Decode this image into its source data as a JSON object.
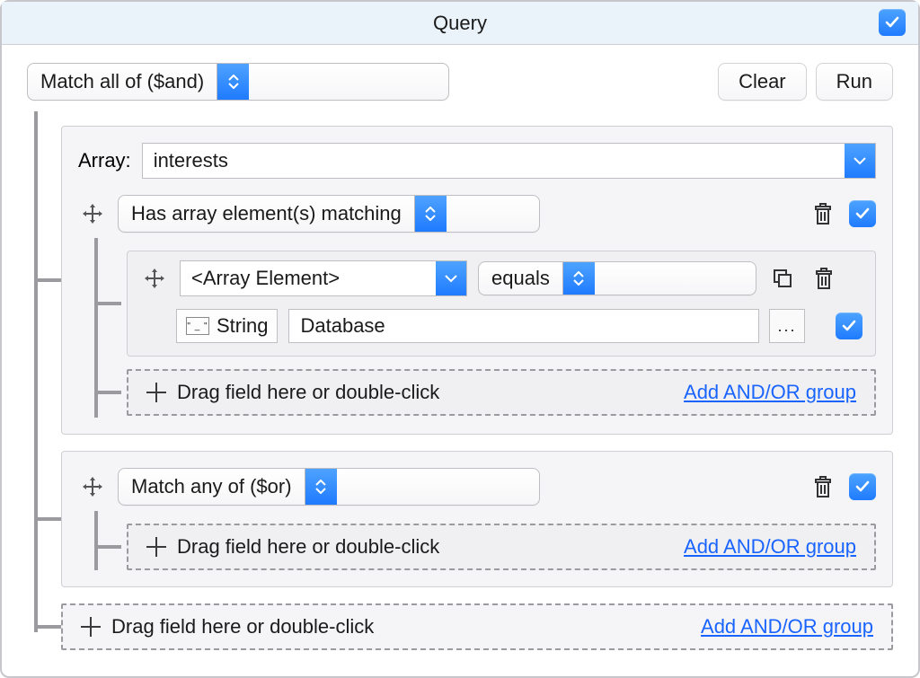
{
  "titlebar": {
    "title": "Query"
  },
  "toolbar": {
    "main_mode": "Match all of ($and)",
    "clear": "Clear",
    "run": "Run"
  },
  "group1": {
    "array_label": "Array:",
    "array_field": "interests",
    "match_mode": "Has array element(s) matching",
    "element": {
      "field": "<Array Element>",
      "operator": "equals",
      "type": "String",
      "value": "Database"
    },
    "dropzone_text": "Drag field here or double-click",
    "add_link": "Add AND/OR group"
  },
  "group2": {
    "match_mode": "Match any of ($or)",
    "dropzone_text": "Drag field here or double-click",
    "add_link": "Add AND/OR group"
  },
  "root_drop": {
    "dropzone_text": "Drag field here or double-click",
    "add_link": "Add AND/OR group"
  },
  "dots": "..."
}
